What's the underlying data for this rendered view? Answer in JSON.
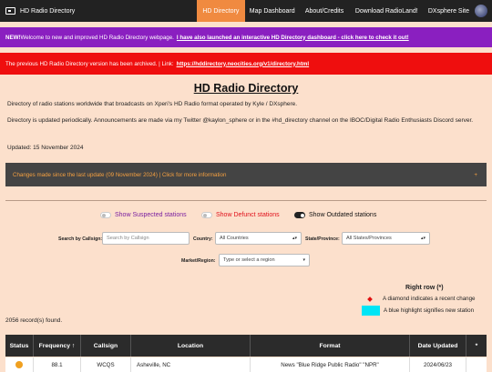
{
  "nav": {
    "brand": "HD Radio Directory",
    "links": [
      "HD Directory",
      "Map Dashboard",
      "About/Credits",
      "Download RadioLand!",
      "DXsphere Site"
    ]
  },
  "banners": {
    "new_prefix": "NEW!",
    "new_text": " Welcome to new and improved HD Radio Directory webpage.",
    "new_link": "I have also launched an interactive HD Directory dashboard - click here to check it out!",
    "archived_text": "The previous HD Radio Directory version has been archived.  |  Link:",
    "archived_link": "https://hddirectory.neocities.org/v1/directory.html"
  },
  "page": {
    "title": "HD Radio Directory",
    "desc": "Directory of radio stations worldwide that broadcasts on Xperi's HD Radio format operated by Kyle / DXsphere.",
    "update_note": "Directory is updated periodically. Announcements are made via my Twitter @kaylon_sphere or in the #hd_directory channel on the IBOC/Digital Radio Enthusiasts Discord server.",
    "updated": "Updated: 15 November 2024"
  },
  "changes": {
    "label": "Changes made since the last update (09 November 2024)  |  Click for more information",
    "toggle_symbol": "+"
  },
  "toggles": {
    "suspected": "Show Suspected stations",
    "defunct": "Show Defunct stations",
    "outdated": "Show Outdated stations"
  },
  "filters": {
    "callsign_label": "Search by Callsign:",
    "callsign_placeholder": "Search by Callsign",
    "country_label": "Country:",
    "country_value": "All Countries",
    "state_label": "State/Province:",
    "state_value": "All States/Provinces",
    "market_label": "Market/Region:",
    "market_placeholder": "Type or select a region"
  },
  "legend": {
    "title": "Right row (*)",
    "diamond_text": "A diamond indicates a recent change",
    "cyan_text": "A blue highlight signifies new station",
    "diamond_color": "#e01010",
    "cyan_color": "#00e5f5"
  },
  "records": "2056 record(s) found.",
  "table": {
    "headers": [
      "Status",
      "Frequency ↑",
      "Callsign",
      "Location",
      "Format",
      "Date Updated",
      "*"
    ],
    "rows": [
      {
        "status_color": "#f0a020",
        "frequency": "88.1",
        "callsign": "WCQS",
        "location": "Asheville, NC",
        "format": "News \"Blue Ridge Public Radio\" \"NPR\"",
        "date": "2024/06/23",
        "star": ""
      }
    ]
  },
  "colors": {
    "accent": "#f08a40",
    "background": "#fce0cc",
    "nav": "#222222",
    "banner_purple": "#8a1fc0",
    "banner_red": "#ef0e0e"
  }
}
